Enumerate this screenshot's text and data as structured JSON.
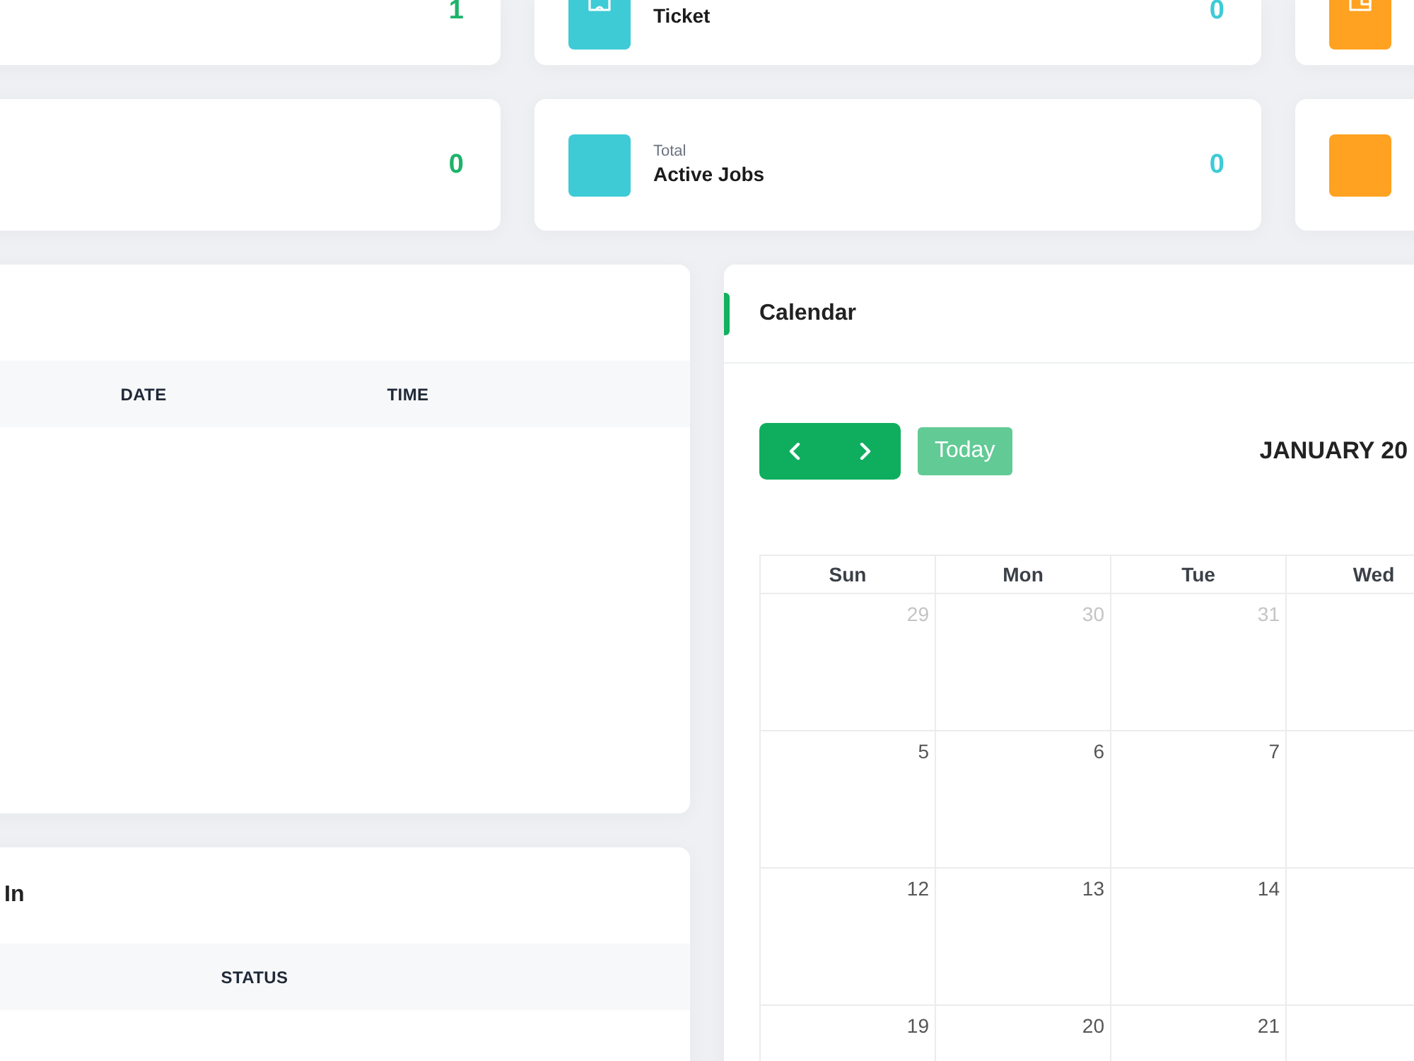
{
  "stat_rows": [
    {
      "cards": [
        {
          "kind": "value_only",
          "value": "1",
          "color": "#1db36a"
        },
        {
          "kind": "full",
          "label": "Ticket",
          "value": "0",
          "color": "#3ecbd6"
        },
        {
          "kind": "icon_only",
          "color": "#ffa221"
        }
      ]
    },
    {
      "cards": [
        {
          "kind": "value_only",
          "value": "0",
          "color": "#1db36a"
        },
        {
          "kind": "full",
          "caption": "Total",
          "label": "Active Jobs",
          "value": "0",
          "color": "#3ecbd6"
        },
        {
          "kind": "icon_only",
          "color": "#ffa221"
        }
      ]
    }
  ],
  "panels": [
    {
      "columns": [
        "DATE",
        "TIME"
      ]
    },
    {
      "title": "In",
      "columns": [
        "STATUS"
      ]
    }
  ],
  "calendar": {
    "title": "Calendar",
    "today_button": {
      "label": "Today",
      "disabled": true
    },
    "month_title": "JANUARY 20",
    "weekdays": [
      "Sun",
      "Mon",
      "Tue",
      "Wed"
    ],
    "weeks": [
      {
        "days": [
          {
            "label": "29",
            "other_month": true
          },
          {
            "label": "30",
            "other_month": true
          },
          {
            "label": "31",
            "other_month": true
          }
        ]
      },
      {
        "days": [
          {
            "label": "5",
            "other_month": false
          },
          {
            "label": "6",
            "other_month": false
          },
          {
            "label": "7",
            "other_month": false
          }
        ]
      },
      {
        "days": [
          {
            "label": "12",
            "other_month": false
          },
          {
            "label": "13",
            "other_month": false
          },
          {
            "label": "14",
            "other_month": false
          }
        ]
      },
      {
        "days": [
          {
            "label": "19",
            "other_month": false
          },
          {
            "label": "20",
            "other_month": false
          },
          {
            "label": "21",
            "other_month": false
          }
        ]
      }
    ]
  }
}
